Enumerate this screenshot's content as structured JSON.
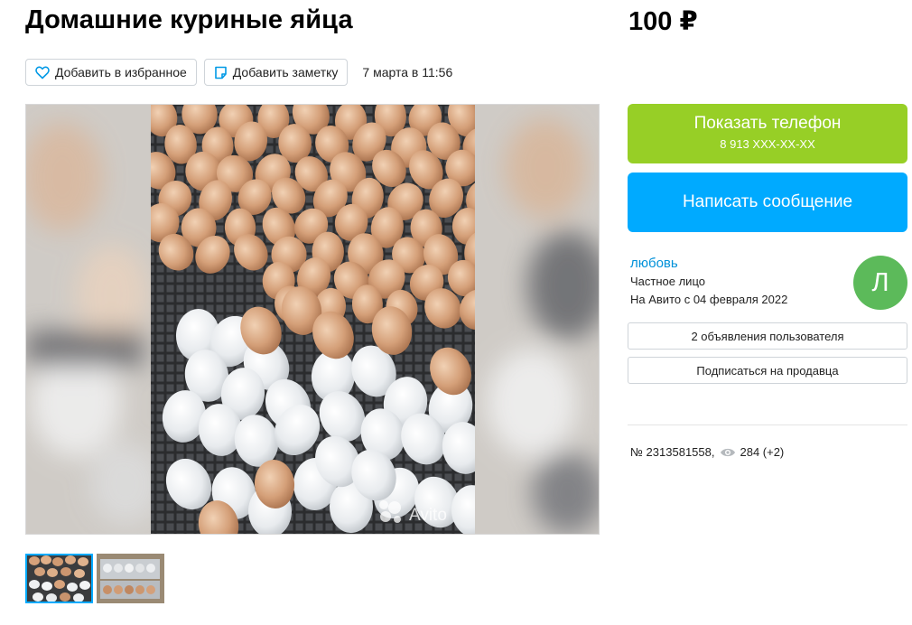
{
  "listing": {
    "title": "Домашние куриные яйца",
    "price": "100 ₽",
    "date": "7 марта в 11:56",
    "id_text": "№ 2313581558,",
    "views_text": "284 (+2)"
  },
  "actions": {
    "favorite_label": "Добавить в избранное",
    "note_label": "Добавить заметку"
  },
  "gallery": {
    "watermark": "Avito",
    "thumbnails_count": 2,
    "active_thumbnail": 1
  },
  "contact": {
    "phone_button_label": "Показать телефон",
    "phone_masked": "8 913 XXX-XX-XX",
    "message_button_label": "Написать сообщение"
  },
  "seller": {
    "name": "любовь",
    "type": "Частное лицо",
    "since": "На Авито с 04 февраля 2022",
    "avatar_letter": "Л",
    "ads_button_label": "2 объявления пользователя",
    "subscribe_button_label": "Подписаться на продавца"
  },
  "colors": {
    "accent_green": "#97cf26",
    "accent_blue": "#00aaff",
    "link_blue": "#0091d9",
    "avatar_green": "#5cba5a"
  },
  "icons": [
    "heart-icon",
    "note-icon",
    "eye-icon",
    "avito-logo-icon"
  ]
}
